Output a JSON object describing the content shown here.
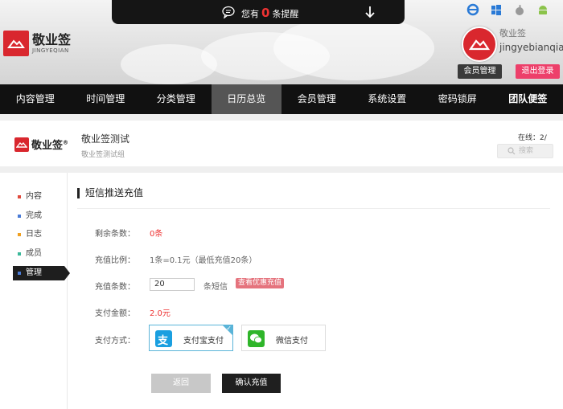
{
  "brand": {
    "name_cn": "敬业签",
    "name_en": "JINGYEQIAN"
  },
  "notice": {
    "prefix": "您有",
    "count": "0",
    "suffix": "条提醒"
  },
  "platforms": [
    {
      "name": "ie-icon",
      "color": "#2a7ad6"
    },
    {
      "name": "windows-icon",
      "color": "#2a7ad6"
    },
    {
      "name": "apple-icon",
      "color": "#999999"
    },
    {
      "name": "android-icon",
      "color": "#8bc34a"
    }
  ],
  "user": {
    "label": "敬业签",
    "name": "jingyebianqian",
    "member_btn": "会员管理",
    "logout_btn": "退出登录"
  },
  "nav": [
    {
      "label": "内容管理",
      "active": false
    },
    {
      "label": "时间管理",
      "active": false
    },
    {
      "label": "分类管理",
      "active": false
    },
    {
      "label": "日历总览",
      "active": true
    },
    {
      "label": "会员管理",
      "active": false
    },
    {
      "label": "系统设置",
      "active": false
    },
    {
      "label": "密码锁屏",
      "active": false
    },
    {
      "label": "团队便签",
      "active": false
    }
  ],
  "team": {
    "logo_text": "敬业签",
    "reg_mark": "®",
    "name": "敬业签测试",
    "sub": "敬业签测试组",
    "online": "在线：2/",
    "search_placeholder": "搜索"
  },
  "sidebar": [
    {
      "label": "内容",
      "color": "#e04a3c",
      "active": false
    },
    {
      "label": "完成",
      "color": "#4a7bd6",
      "active": false
    },
    {
      "label": "日志",
      "color": "#f0a020",
      "active": false
    },
    {
      "label": "成员",
      "color": "#3bb89a",
      "active": false
    },
    {
      "label": "管理",
      "color": "#4a7bd6",
      "active": true
    }
  ],
  "form": {
    "title": "短信推送充值",
    "remaining_label": "剩余条数：",
    "remaining_value": "0条",
    "ratio_label": "充值比例：",
    "ratio_value": "1条=0.1元（最低充值20条）",
    "count_label": "充值条数：",
    "count_value": "20",
    "count_unit": "条短信",
    "offer_tag": "查看优惠充值",
    "amount_label": "支付金额：",
    "amount_value": "2.0元",
    "method_label": "支付方式：",
    "alipay": "支付宝支付",
    "alipay_icon_char": "支",
    "wechat": "微信支付",
    "back_btn": "返回",
    "confirm_btn": "确认充值"
  }
}
